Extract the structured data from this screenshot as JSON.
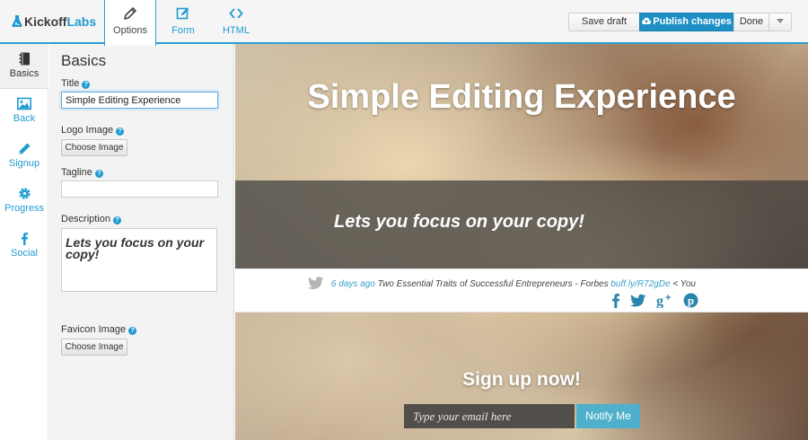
{
  "brand": {
    "logo_text_a": "Kickoff",
    "logo_text_b": "Labs"
  },
  "tabs": [
    {
      "label": "Options",
      "icon": "pencil-icon",
      "active": true
    },
    {
      "label": "Form",
      "icon": "edit-box-icon",
      "active": false
    },
    {
      "label": "HTML",
      "icon": "code-icon",
      "active": false
    }
  ],
  "toolbar": {
    "save_label": "Save draft",
    "publish_label": "Publish changes",
    "done_label": "Done",
    "publish_color": "#1e8fc4"
  },
  "sidenav": [
    {
      "label": "Basics",
      "icon": "notebook-icon",
      "active": true
    },
    {
      "label": "Back",
      "icon": "image-icon",
      "active": false
    },
    {
      "label": "Signup",
      "icon": "pencil-icon",
      "active": false
    },
    {
      "label": "Progress",
      "icon": "gear-icon",
      "active": false
    },
    {
      "label": "Social",
      "icon": "facebook-icon",
      "active": false
    }
  ],
  "panel": {
    "title": "Basics",
    "title_field": {
      "label": "Title",
      "value": "Simple Editing Experience"
    },
    "logo_field": {
      "label": "Logo Image",
      "button": "Choose Image"
    },
    "tagline_field": {
      "label": "Tagline",
      "value": ""
    },
    "description_field": {
      "label": "Description",
      "value": "Lets you focus on your copy!"
    },
    "favicon_field": {
      "label": "Favicon Image",
      "button": "Choose Image"
    }
  },
  "preview": {
    "hero_title": "Simple Editing Experience",
    "tagline": "Lets you focus on your copy!",
    "tweet": {
      "age": "6 days ago",
      "text": "Two Essential Traits of Successful Entrepreneurs - Forbes",
      "link": "buff.ly/R72gDe",
      "suffix": "< You"
    },
    "social_icons": [
      "facebook-icon",
      "twitter-icon",
      "google-plus-icon",
      "pinterest-icon"
    ],
    "signup_title": "Sign up now!",
    "email_placeholder": "Type your email here",
    "notify_label": "Notify Me",
    "accent_color": "#4fb0cc"
  }
}
